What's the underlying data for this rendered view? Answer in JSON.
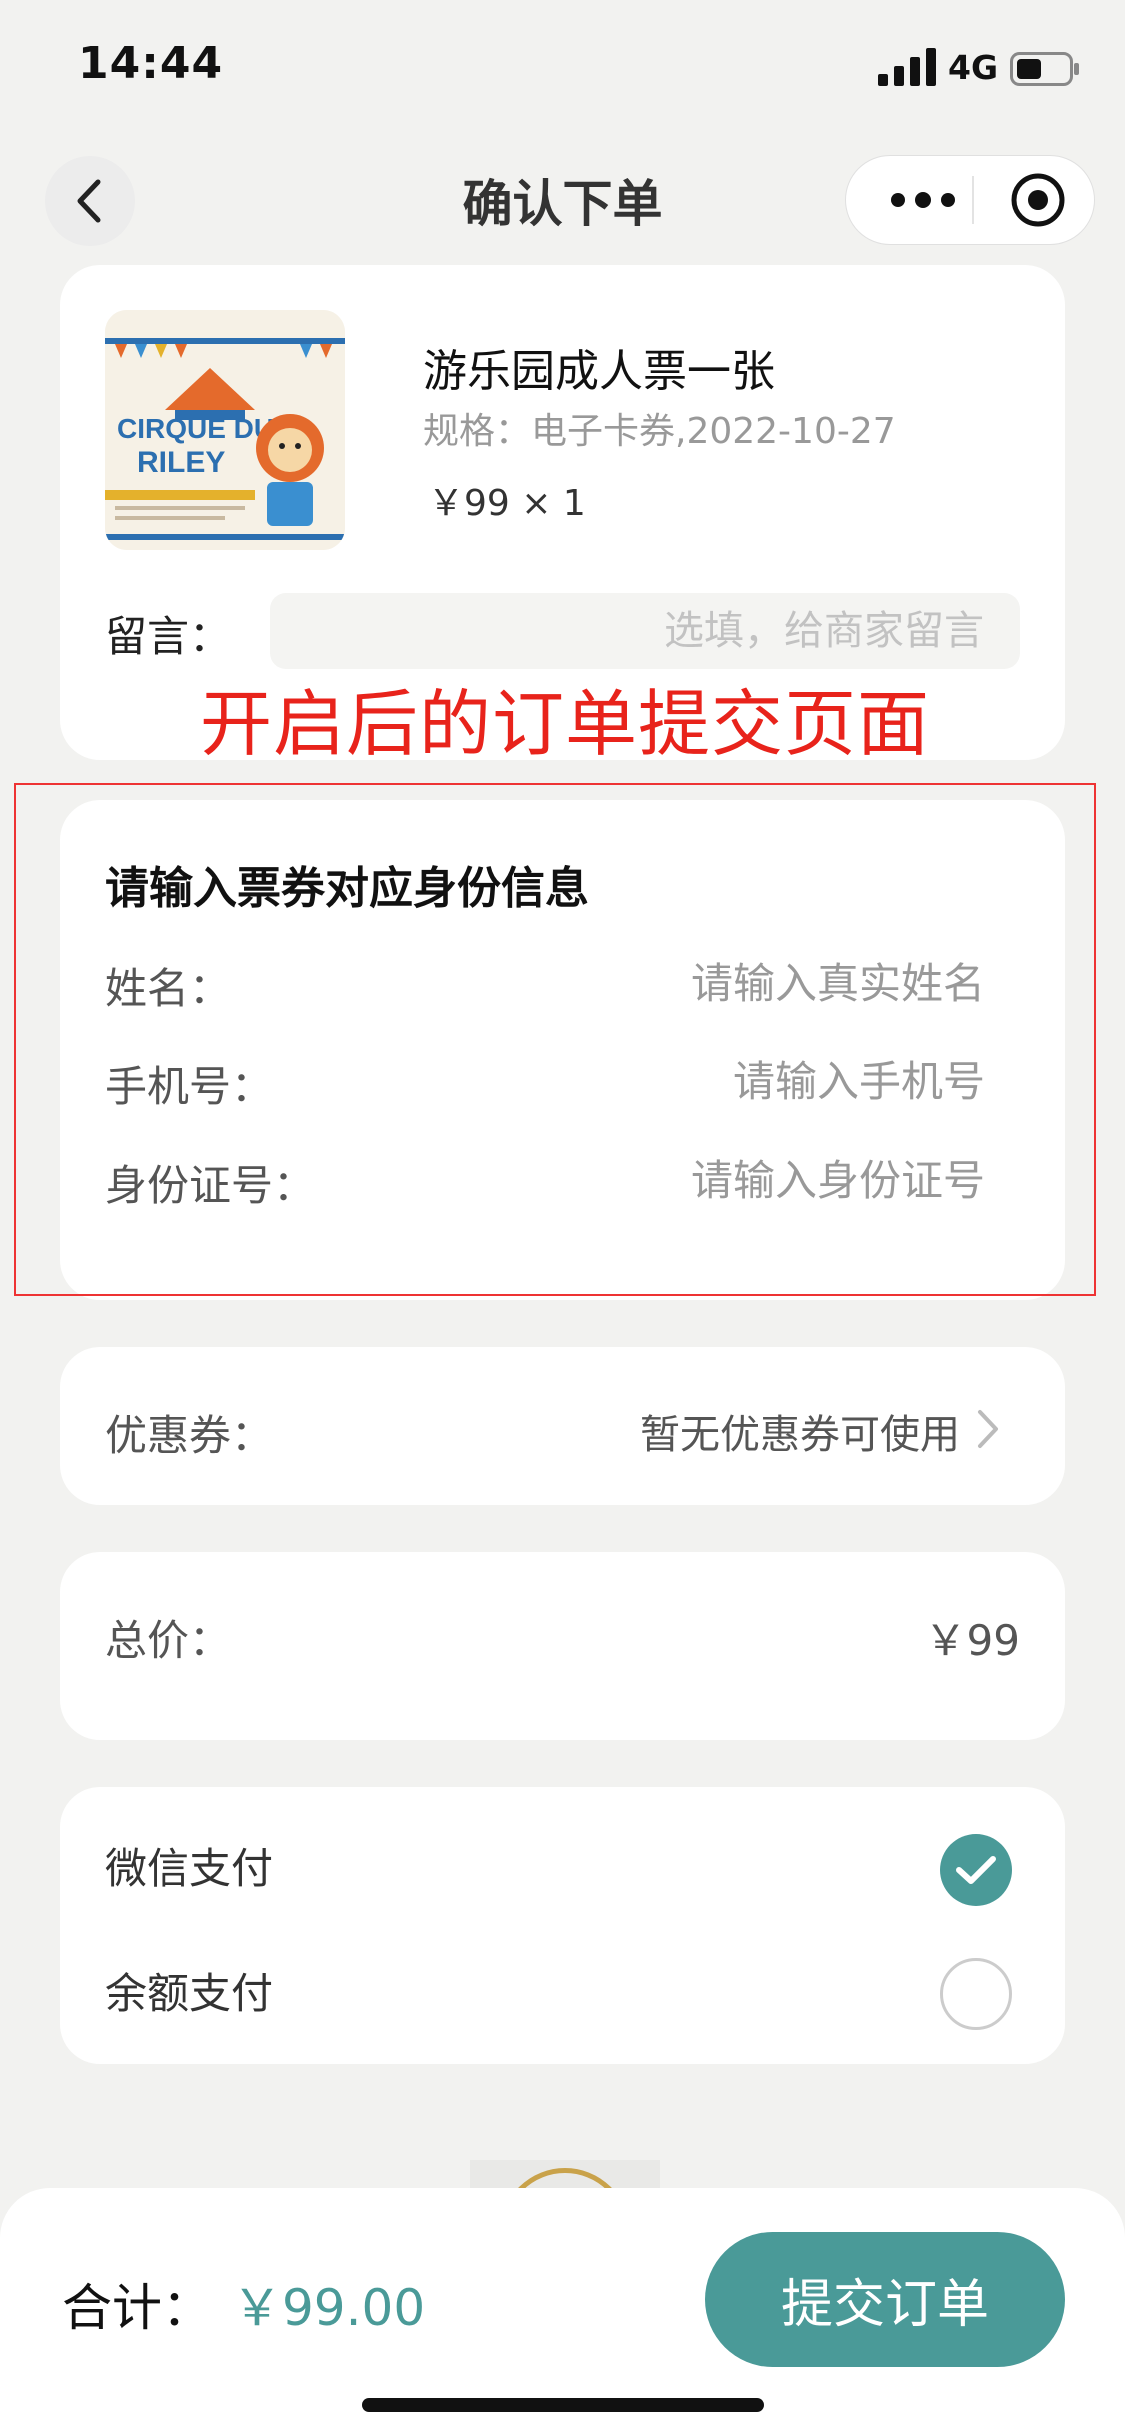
{
  "status_bar": {
    "time": "14:44",
    "network": "4G"
  },
  "nav": {
    "title": "确认下单",
    "icons": [
      "back-arrow-icon",
      "more-dots-icon",
      "target-icon"
    ]
  },
  "product": {
    "image_icon": "circus-ticket-image",
    "name": "游乐园成人票一张",
    "spec": "规格：电子卡券,2022-10-27",
    "price": "￥99 × 1"
  },
  "message": {
    "label": "留言：",
    "placeholder": "选填，给商家留言"
  },
  "annotation": {
    "text": "开启后的订单提交页面",
    "color": "#e8231b"
  },
  "identity": {
    "title": "请输入票券对应身份信息",
    "fields": [
      {
        "label": "姓名：",
        "placeholder": "请输入真实姓名"
      },
      {
        "label": "手机号：",
        "placeholder": "请输入手机号"
      },
      {
        "label": "身份证号：",
        "placeholder": "请输入身份证号"
      }
    ]
  },
  "coupon": {
    "label": "优惠券：",
    "value": "暂无优惠券可使用"
  },
  "total": {
    "label": "总价：",
    "value": "￥99"
  },
  "payment": {
    "options": [
      {
        "label": "微信支付",
        "selected": true
      },
      {
        "label": "余额支付",
        "selected": false
      }
    ]
  },
  "footer": {
    "sum_label": "合计：",
    "sum_value": "￥99.00",
    "submit_label": "提交订单"
  },
  "colors": {
    "accent": "#4a9a98",
    "annotation_red": "#e8231b",
    "background": "#f2f2f0"
  }
}
